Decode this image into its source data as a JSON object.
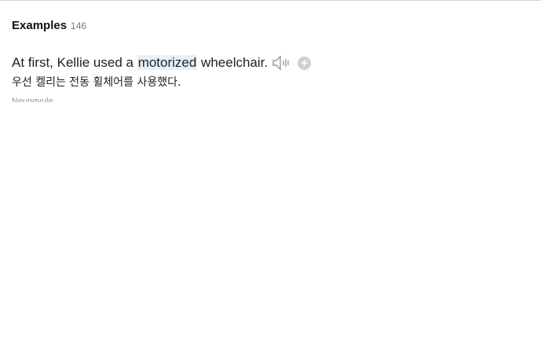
{
  "examples": {
    "title": "Examples",
    "count": "146",
    "items": [
      {
        "sentence_before": "At first, Kellie used a ",
        "sentence_highlight": "motorized",
        "sentence_after": " wheelchair.",
        "translation": "우선 켈리는 전동 휠체어를 사용했다.",
        "source": "Neungyule",
        "speaker_icon": "speaker-icon",
        "add_icon": "plus-circle-icon"
      }
    ]
  },
  "colors": {
    "highlight": "#e6f0fb",
    "add_icon_bg": "#d0d0d0",
    "muted_text": "#999999"
  }
}
